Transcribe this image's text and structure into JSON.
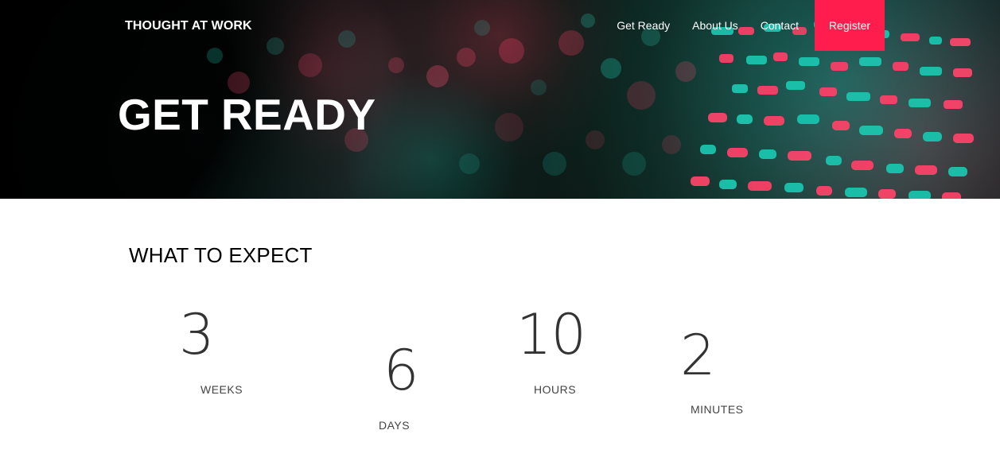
{
  "header": {
    "brand": "THOUGHT AT WORK",
    "nav": [
      {
        "label": "Get Ready"
      },
      {
        "label": "About Us"
      },
      {
        "label": "Contact"
      }
    ],
    "register_label": "Register",
    "accent_color": "#ff1d4e"
  },
  "hero": {
    "title": "GET READY"
  },
  "main": {
    "section_title": "WHAT TO EXPECT",
    "stats": [
      {
        "value": "3",
        "label": "WEEKS"
      },
      {
        "value": "6",
        "label": "DAYS"
      },
      {
        "value": "10",
        "label": "HOURS"
      },
      {
        "value": "2",
        "label": "MINUTES"
      }
    ]
  }
}
